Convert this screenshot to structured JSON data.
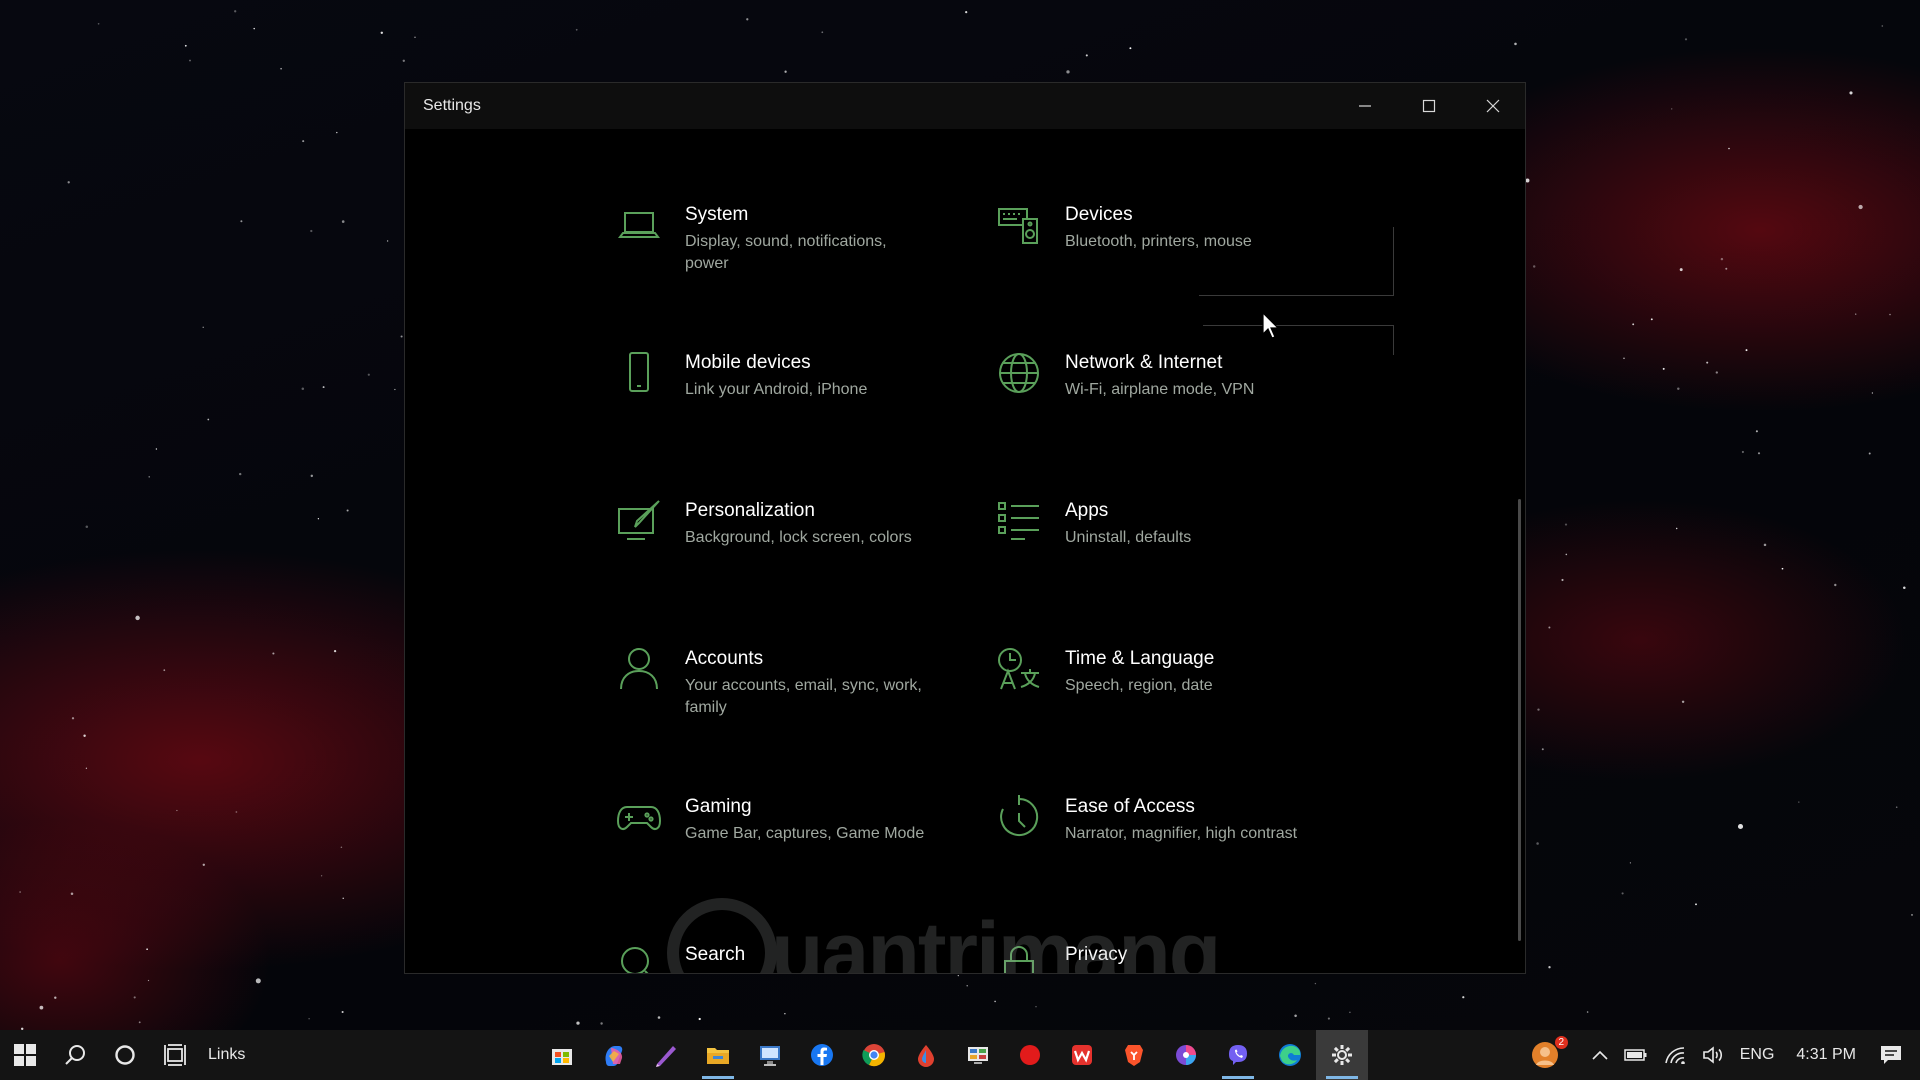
{
  "window": {
    "title": "Settings"
  },
  "tiles": [
    {
      "title": "System",
      "desc": "Display, sound, notifications, power",
      "icon": "laptop-icon"
    },
    {
      "title": "Devices",
      "desc": "Bluetooth, printers, mouse",
      "icon": "keyboard-speaker-icon"
    },
    {
      "title": "Mobile devices",
      "desc": "Link your Android, iPhone",
      "icon": "phone-icon"
    },
    {
      "title": "Network & Internet",
      "desc": "Wi-Fi, airplane mode, VPN",
      "icon": "globe-icon"
    },
    {
      "title": "Personalization",
      "desc": "Background, lock screen, colors",
      "icon": "paint-brush-icon"
    },
    {
      "title": "Apps",
      "desc": "Uninstall, defaults",
      "icon": "apps-list-icon"
    },
    {
      "title": "Accounts",
      "desc": "Your accounts, email, sync, work, family",
      "icon": "person-icon"
    },
    {
      "title": "Time & Language",
      "desc": "Speech, region, date",
      "icon": "time-language-icon"
    },
    {
      "title": "Gaming",
      "desc": "Game Bar, captures, Game Mode",
      "icon": "gamepad-icon"
    },
    {
      "title": "Ease of Access",
      "desc": "Narrator, magnifier, high contrast",
      "icon": "ease-of-access-icon"
    },
    {
      "title": "Search",
      "desc": "",
      "icon": "search-icon"
    },
    {
      "title": "Privacy",
      "desc": "",
      "icon": "lock-icon"
    }
  ],
  "watermark": {
    "text": "uantrimang"
  },
  "taskbar": {
    "links_label": "Links",
    "language": "ENG",
    "time": "4:31 PM",
    "notification_count": "2"
  },
  "colors": {
    "accent": "#5aa05a",
    "window_bg": "#000000",
    "titlebar_bg": "#0e0e0e",
    "taskbar_bg": "#141414"
  }
}
